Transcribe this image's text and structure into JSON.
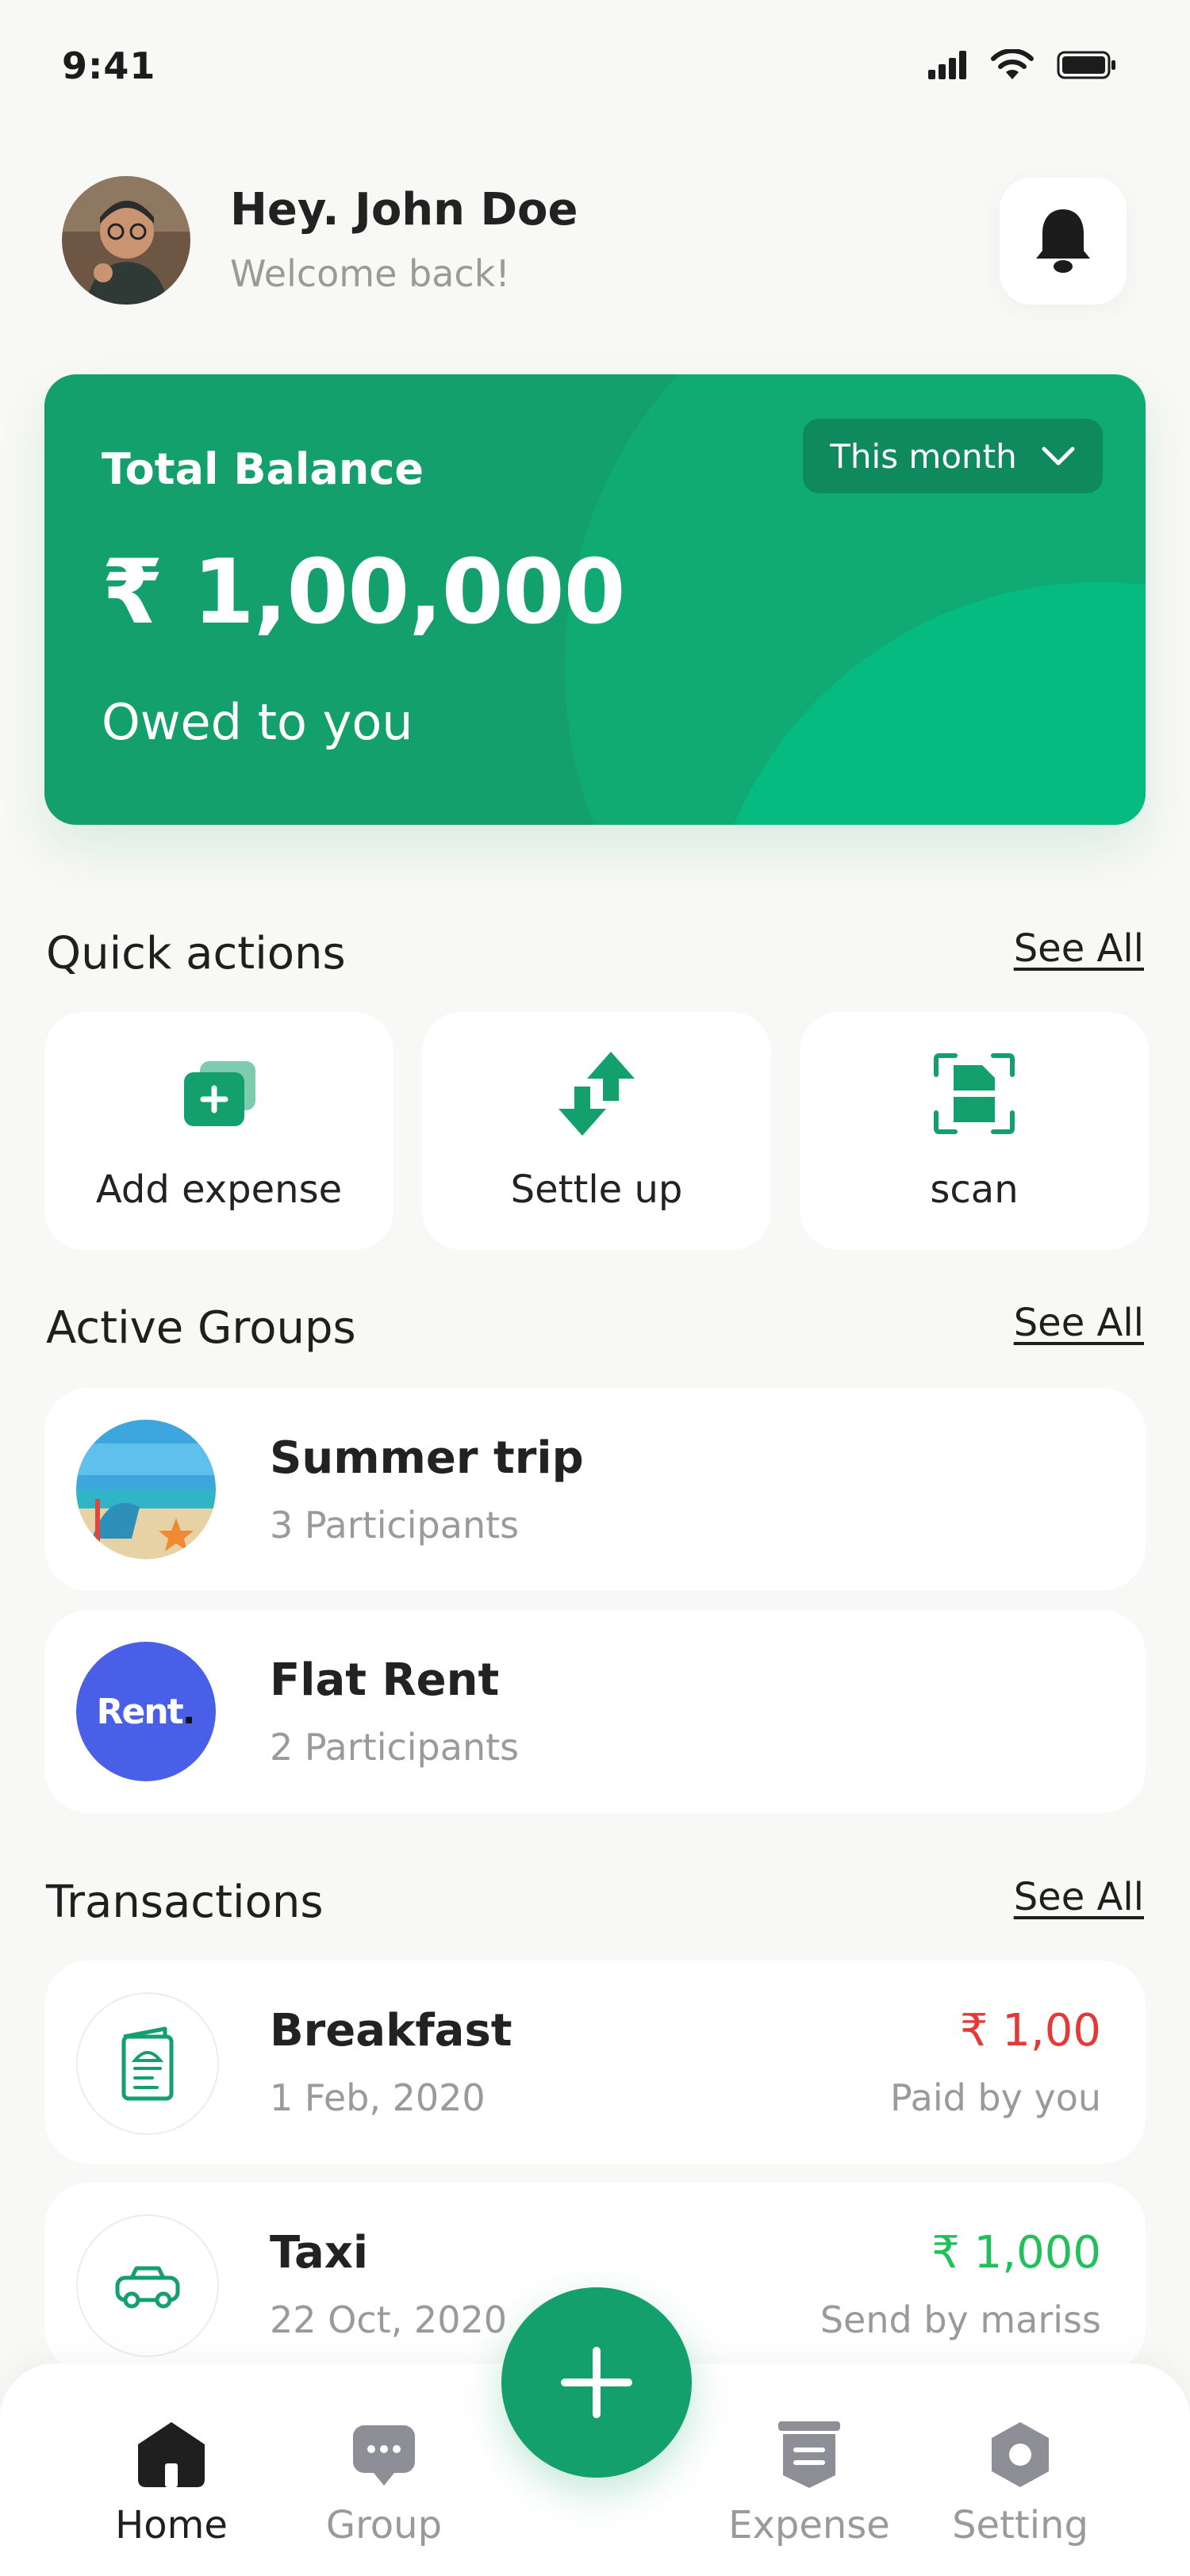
{
  "status_bar": {
    "time": "9:41"
  },
  "header": {
    "greeting": "Hey. John Doe",
    "subtitle": "Welcome back!"
  },
  "balance_card": {
    "title": "Total Balance",
    "amount": "₹ 1,00,000",
    "subtitle": "Owed to you",
    "period": "This month",
    "colors": {
      "card": "#14a06d",
      "accent": "#05bb7f",
      "button": "#0e8a5e"
    }
  },
  "quick_actions": {
    "title": "Quick actions",
    "see_all": "See All",
    "items": [
      {
        "label": "Add expense",
        "icon": "add-expense-icon"
      },
      {
        "label": "Settle up",
        "icon": "settle-up-icon"
      },
      {
        "label": "scan",
        "icon": "scan-icon"
      }
    ]
  },
  "active_groups": {
    "title": "Active Groups",
    "see_all": "See All",
    "items": [
      {
        "name": "Summer trip",
        "participants": "3 Participants",
        "thumb": "beach-image"
      },
      {
        "name": "Flat Rent",
        "participants": "2 Participants",
        "thumb_text": "Rent",
        "thumb_color": "#4a5fe8"
      }
    ]
  },
  "transactions": {
    "title": "Transactions",
    "see_all": "See All",
    "items": [
      {
        "name": "Breakfast",
        "date": "1 Feb, 2020",
        "amount": "₹ 1,00",
        "note": "Paid by you",
        "color": "#e53935",
        "icon": "receipt-icon"
      },
      {
        "name": "Taxi",
        "date": "22 Oct, 2020",
        "amount": "₹ 1,000",
        "note": "Send by mariss",
        "color": "#21c05a",
        "icon": "taxi-icon"
      }
    ]
  },
  "bottom_nav": {
    "items": [
      {
        "label": "Home",
        "icon": "home-icon",
        "active": true
      },
      {
        "label": "Group",
        "icon": "chat-icon",
        "active": false
      },
      {
        "label": "Expense",
        "icon": "expense-icon",
        "active": false
      },
      {
        "label": "Setting",
        "icon": "setting-icon",
        "active": false
      }
    ],
    "fab_icon": "plus-icon"
  }
}
